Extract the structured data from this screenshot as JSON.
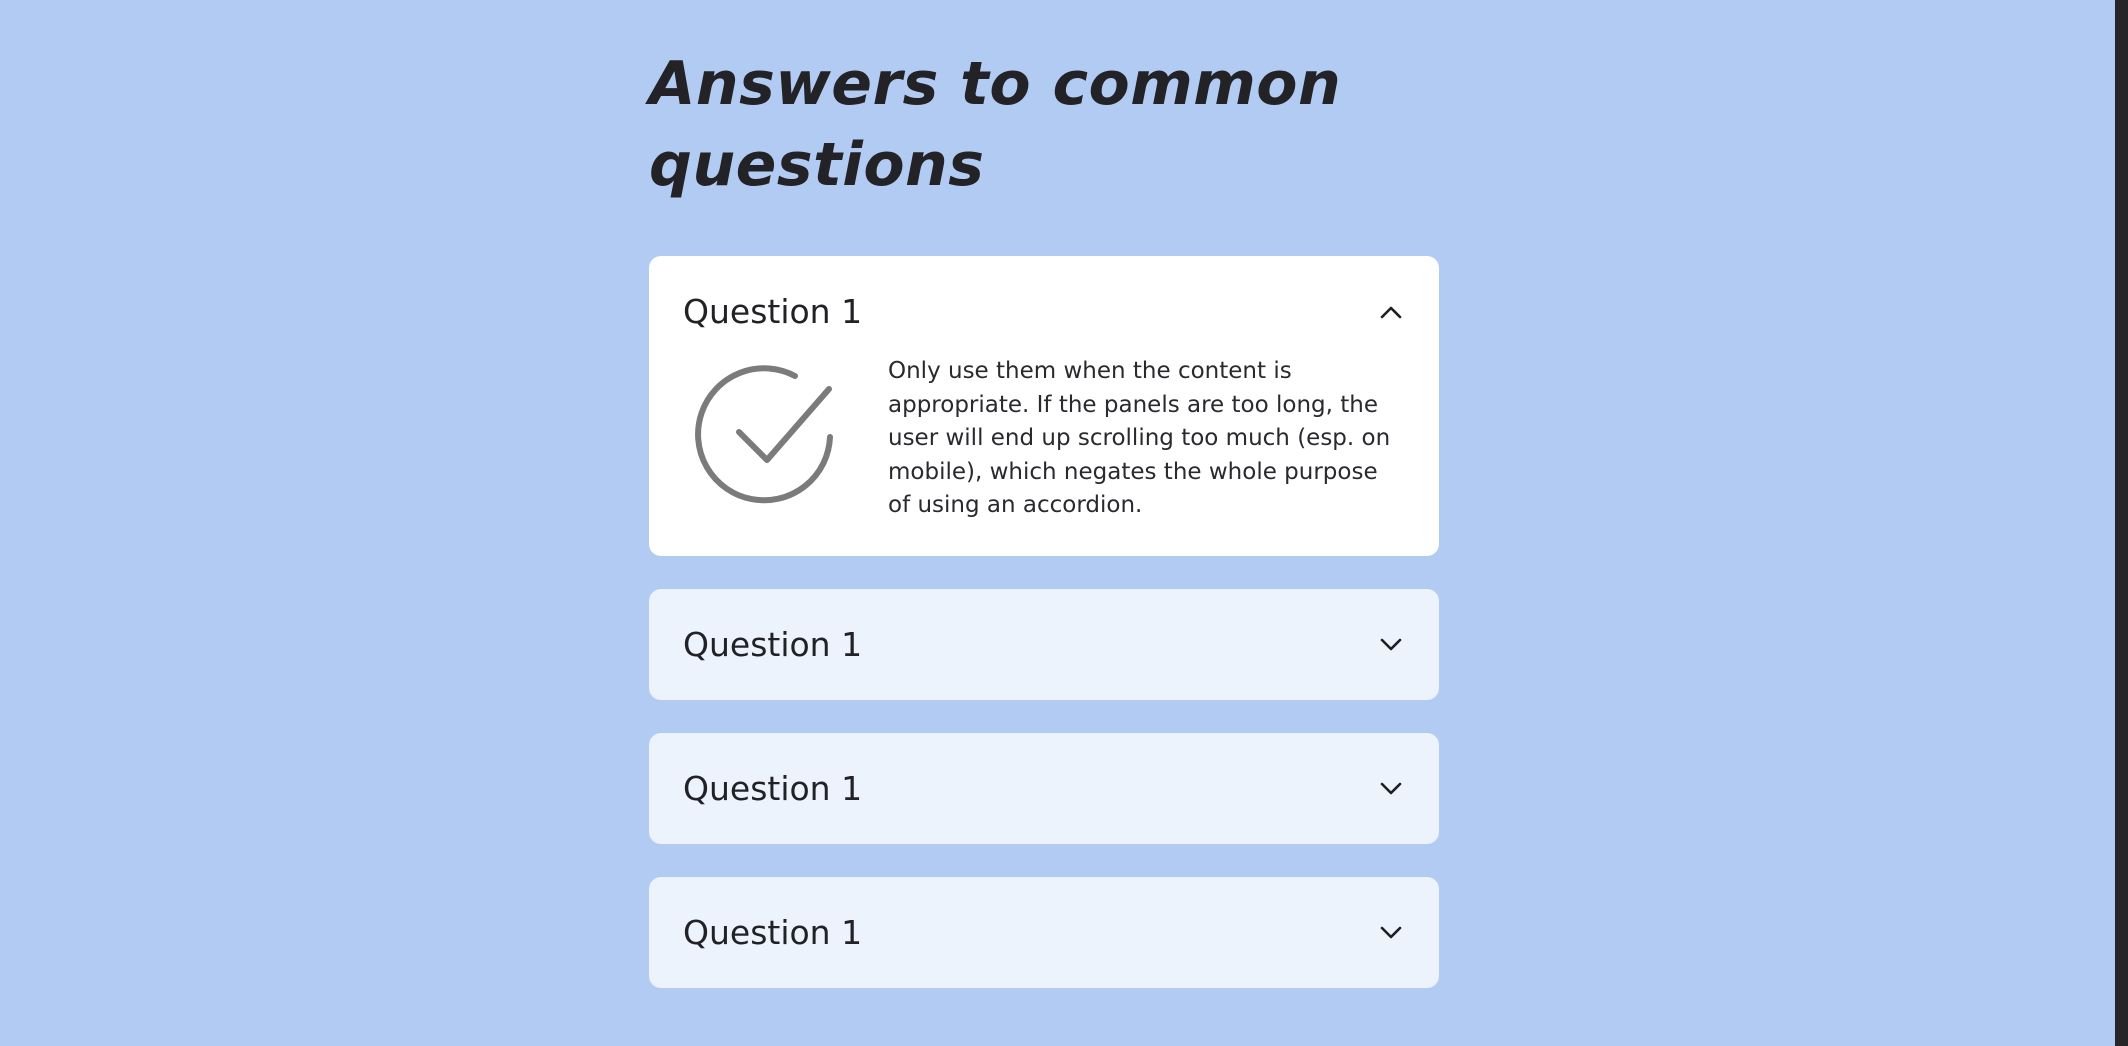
{
  "page": {
    "heading": "Answers to common questions"
  },
  "accordion": {
    "items": [
      {
        "question": "Question 1",
        "expanded": true,
        "icon": "chevron-up-icon",
        "answer": "Only use them when the content is appropriate. If the panels are too long, the user will end up scrolling too much (esp. on mobile), which negates the whole purpose of using an accordion.",
        "answer_icon": "checkmark-circle-icon"
      },
      {
        "question": "Question 1",
        "expanded": false,
        "icon": "chevron-down-icon"
      },
      {
        "question": "Question 1",
        "expanded": false,
        "icon": "chevron-down-icon"
      },
      {
        "question": "Question 1",
        "expanded": false,
        "icon": "chevron-down-icon"
      }
    ]
  },
  "colors": {
    "page_background": "#b2cbf3",
    "open_panel": "#ffffff",
    "closed_panel": "#ecf3fd",
    "text": "#222226",
    "check_icon": "#7b7b7b"
  }
}
